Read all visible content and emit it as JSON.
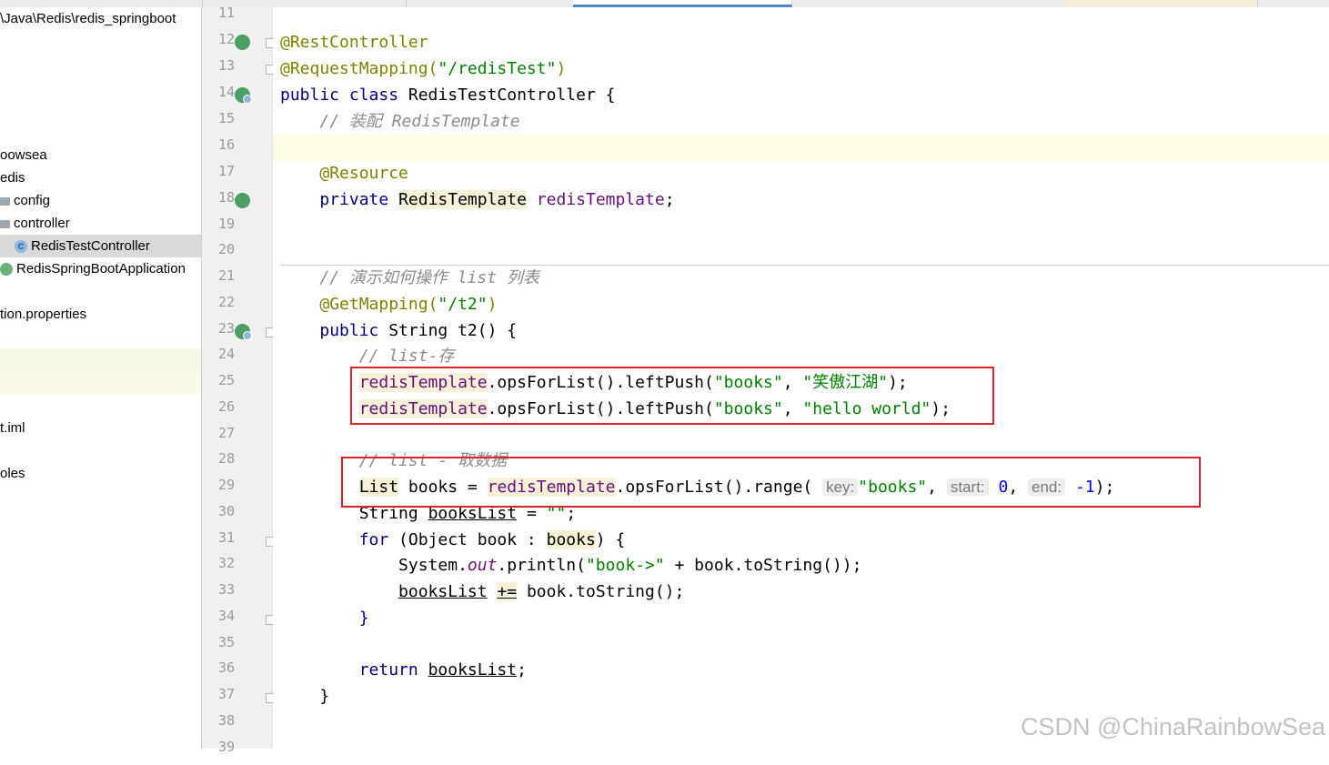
{
  "sidebar": {
    "path": "\\Java\\Redis\\redis_springboot",
    "items": [
      {
        "label": "oowsea"
      },
      {
        "label": "edis"
      },
      {
        "label": "config"
      },
      {
        "label": "controller"
      },
      {
        "label": "RedisTestController",
        "icon_letter": "C"
      },
      {
        "label": "RedisSpringBootApplication"
      },
      {
        "label": "tion.properties"
      },
      {
        "label": "t.iml"
      },
      {
        "label": "oles"
      }
    ]
  },
  "gutter": {
    "line_numbers": [
      "11",
      "12",
      "13",
      "14",
      "15",
      "16",
      "17",
      "18",
      "19",
      "20",
      "21",
      "22",
      "23",
      "24",
      "25",
      "26",
      "27",
      "28",
      "29",
      "30",
      "31",
      "32",
      "33",
      "34",
      "35",
      "36",
      "37",
      "38",
      "39"
    ]
  },
  "code": {
    "l12": "@RestController",
    "l13_ann": "@RequestMapping(",
    "l13_str": "\"/redisTest\"",
    "l13_end": ")",
    "l14_kw": "public class",
    "l14_rest": " RedisTestController {",
    "l15": "// 装配 RedisTemplate",
    "l17": "@Resource",
    "l18_kw": "private",
    "l18_type": "RedisTemplate",
    "l18_field": "redisTemplate",
    "l18_end": ";",
    "l21": "// 演示如何操作 list 列表",
    "l22_ann": "@GetMapping(",
    "l22_str": "\"/t2\"",
    "l22_end": ")",
    "l23_kw": "public",
    "l23_rest": " String t2() {",
    "l24": "// list-存",
    "l25_field": "redisTemplate",
    "l25_mid": ".opsForList().leftPush(",
    "l25_s1": "\"books\"",
    "l25_comma": ", ",
    "l25_s2": "\"笑傲江湖\"",
    "l25_end": ");",
    "l26_field": "redisTemplate",
    "l26_mid": ".opsForList().leftPush(",
    "l26_s1": "\"books\"",
    "l26_comma": ", ",
    "l26_s2": "\"hello world\"",
    "l26_end": ");",
    "l28": "// list - 取数据",
    "l29_type": "List",
    "l29_a": " books = ",
    "l29_field": "redisTemplate",
    "l29_b": ".opsForList().range(",
    "l29_h1": "key:",
    "l29_s1": "\"books\"",
    "l29_c1": ", ",
    "l29_h2": "start:",
    "l29_n1": "0",
    "l29_c2": ", ",
    "l29_h3": "end:",
    "l29_n2": "-1",
    "l29_end": ");",
    "l30_a": "String ",
    "l30_var": "booksList",
    "l30_b": " = ",
    "l30_s": "\"\"",
    "l30_end": ";",
    "l31_kw": "for",
    "l31_a": " (Object book : ",
    "l31_var": "books",
    "l31_end": ") {",
    "l32_a": "System.",
    "l32_static": "out",
    "l32_b": ".println(",
    "l32_s": "\"book->\"",
    "l32_end": " + book.toString());",
    "l33_var": "booksList",
    "l33_op": "+=",
    "l33_end": " book.toString();",
    "l34": "}",
    "l36_kw": "return",
    "l36_var": "booksList",
    "l36_end": ";",
    "l37": "}"
  },
  "watermark": "CSDN @ChinaRainbowSea",
  "colors": {
    "annotation": "#808000",
    "keyword": "#000080",
    "string": "#008000",
    "comment": "#8c8c8c",
    "field": "#660e7a",
    "number": "#0000ff",
    "highlight_box": "#d6262b"
  }
}
